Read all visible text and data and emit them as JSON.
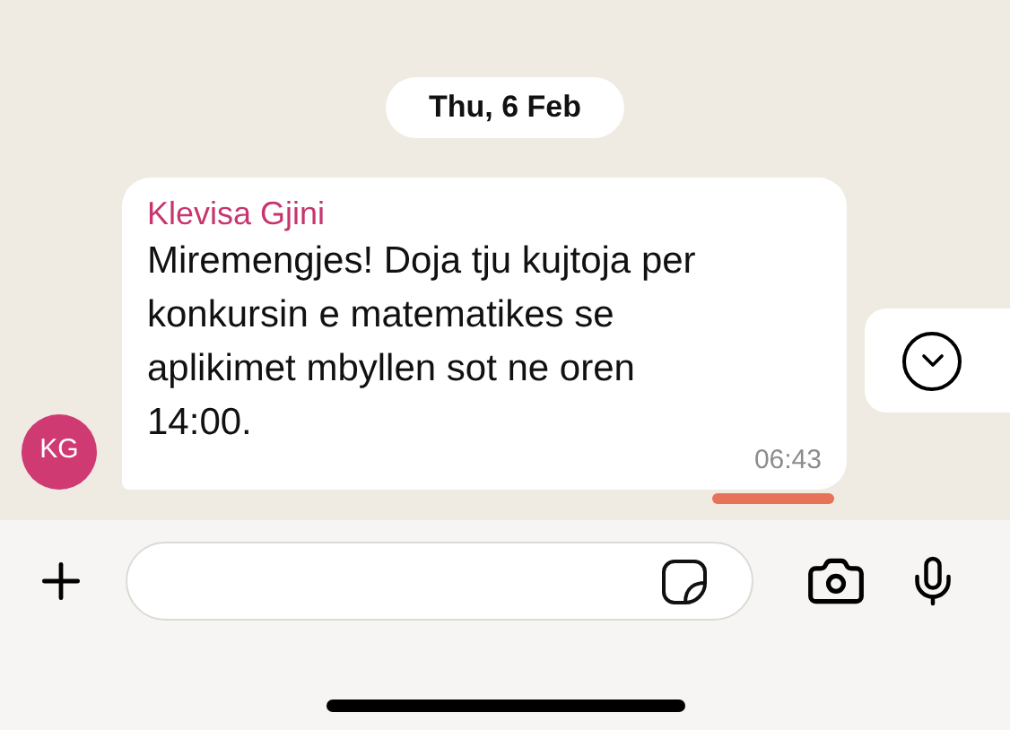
{
  "date_separator": "Thu, 6 Feb",
  "message": {
    "avatar_initials": "KG",
    "sender": "Klevisa Gjini",
    "text": "Miremengjes! Doja tju kujtoja per konkursin e matematikes se aplikimet mbyllen sot ne oren 14:00.",
    "time": "06:43"
  }
}
